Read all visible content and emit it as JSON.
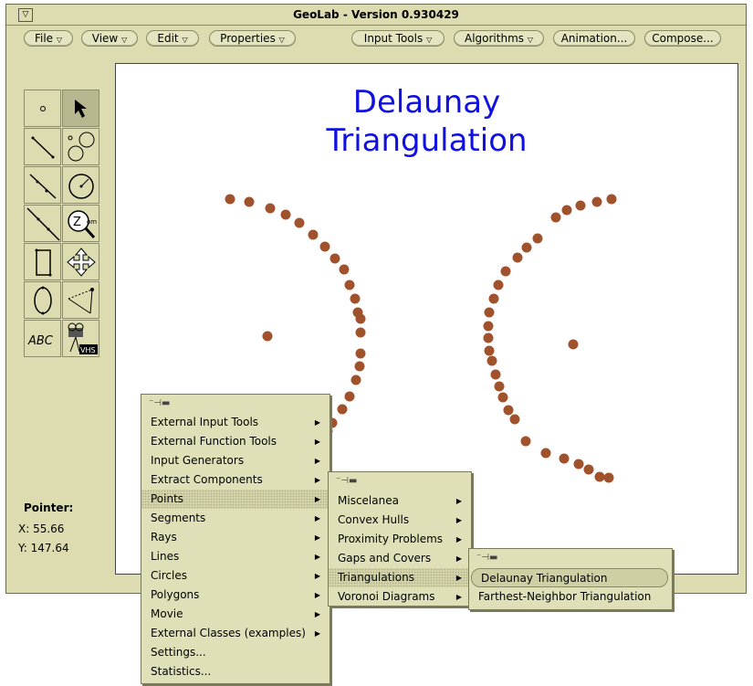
{
  "window": {
    "title": "GeoLab - Version 0.930429",
    "menu_glyph": "▽"
  },
  "menubar": {
    "items": [
      {
        "label": "File"
      },
      {
        "label": "View"
      },
      {
        "label": "Edit"
      },
      {
        "label": "Properties"
      },
      {
        "label": "Input Tools"
      },
      {
        "label": "Algorithms"
      },
      {
        "label": "Animation..."
      },
      {
        "label": "Compose..."
      }
    ],
    "dropdown_glyph": "▽"
  },
  "canvas": {
    "title_line1": "Delaunay",
    "title_line2": "Triangulation",
    "point_color": "#a0522d",
    "title_color": "#1010e0"
  },
  "tools": {
    "text_tool_label": "ABC",
    "zoom_label": "Zoom",
    "vhs_label": "VHS"
  },
  "pointer": {
    "heading": "Pointer:",
    "x": "X: 55.66",
    "y": "Y: 147.64"
  },
  "menu_pin": "⁻⊣▬",
  "menu1": {
    "items": [
      {
        "label": "External Input Tools",
        "sub": true
      },
      {
        "label": "External Function Tools",
        "sub": true
      },
      {
        "label": "Input Generators",
        "sub": true
      },
      {
        "label": "Extract Components",
        "sub": true
      },
      {
        "label": "Points",
        "sub": true
      },
      {
        "label": "Segments",
        "sub": true
      },
      {
        "label": "Rays",
        "sub": true
      },
      {
        "label": "Lines",
        "sub": true
      },
      {
        "label": "Circles",
        "sub": true
      },
      {
        "label": "Polygons",
        "sub": true
      },
      {
        "label": "Movie",
        "sub": true
      },
      {
        "label": "External Classes (examples)",
        "sub": true
      },
      {
        "label": "Settings...",
        "sub": false
      },
      {
        "label": "Statistics...",
        "sub": false
      }
    ]
  },
  "menu2": {
    "items": [
      {
        "label": "Miscelanea"
      },
      {
        "label": "Convex Hulls"
      },
      {
        "label": "Proximity Problems"
      },
      {
        "label": "Gaps and Covers"
      },
      {
        "label": "Triangulations"
      },
      {
        "label": "Voronoi Diagrams"
      }
    ]
  },
  "menu3": {
    "items": [
      {
        "label": "Delaunay Triangulation"
      },
      {
        "label": "Farthest-Neighbor Triangulation"
      }
    ]
  },
  "submenu_arrow": "▶"
}
